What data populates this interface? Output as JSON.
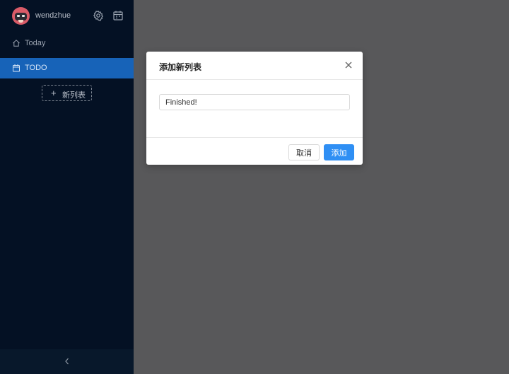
{
  "sidebar": {
    "username": "wendzhue",
    "header_icons": [
      "gear-icon",
      "calendar-icon"
    ],
    "items": [
      {
        "label": "Today",
        "icon": "home-icon",
        "active": false
      },
      {
        "label": "TODO",
        "icon": "calendar-icon",
        "active": true
      }
    ],
    "new_list_label": "新列表",
    "collapse_icon": "chevron-left-icon"
  },
  "modal": {
    "title": "添加新列表",
    "input_value": "Finished!",
    "cancel_label": "取消",
    "ok_label": "添加"
  },
  "colors": {
    "sidebar_bg": "#041124",
    "active_item": "#1763b8",
    "primary": "#2f8ff4",
    "overlay": "#58585a"
  }
}
